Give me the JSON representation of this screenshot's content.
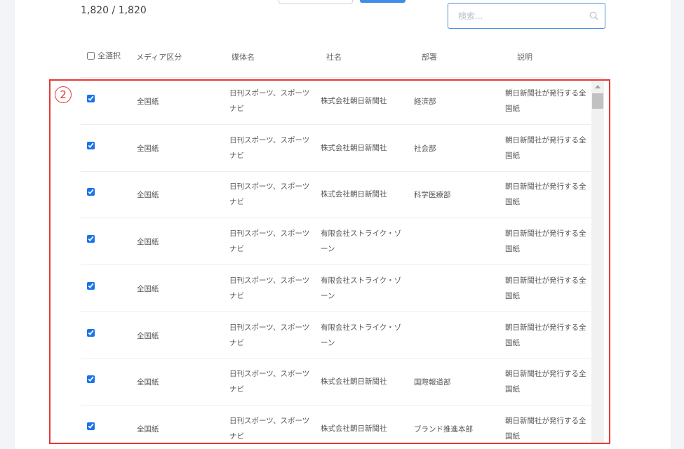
{
  "header": {
    "count_text": "1,820 / 1,820"
  },
  "search": {
    "placeholder": "検索..."
  },
  "table": {
    "columns": {
      "select_all": "全選択",
      "media_type": "メディア区分",
      "outlet": "媒体名",
      "company": "社名",
      "department": "部署",
      "description": "説明"
    },
    "rows": [
      {
        "checked": true,
        "media": "全国紙",
        "outlet": "日刊スポーツ、スポーツナビ",
        "company": "株式会社朝日新聞社",
        "dept": "経済部",
        "desc": "朝日新聞社が発行する全国紙"
      },
      {
        "checked": true,
        "media": "全国紙",
        "outlet": "日刊スポーツ、スポーツナビ",
        "company": "株式会社朝日新聞社",
        "dept": "社会部",
        "desc": "朝日新聞社が発行する全国紙"
      },
      {
        "checked": true,
        "media": "全国紙",
        "outlet": "日刊スポーツ、スポーツナビ",
        "company": "株式会社朝日新聞社",
        "dept": "科学医療部",
        "desc": "朝日新聞社が発行する全国紙"
      },
      {
        "checked": true,
        "media": "全国紙",
        "outlet": "日刊スポーツ、スポーツナビ",
        "company": "有限会社ストライク・ゾーン",
        "dept": "",
        "desc": "朝日新聞社が発行する全国紙"
      },
      {
        "checked": true,
        "media": "全国紙",
        "outlet": "日刊スポーツ、スポーツナビ",
        "company": "有限会社ストライク・ゾーン",
        "dept": "",
        "desc": "朝日新聞社が発行する全国紙"
      },
      {
        "checked": true,
        "media": "全国紙",
        "outlet": "日刊スポーツ、スポーツナビ",
        "company": "有限会社ストライク・ゾーン",
        "dept": "",
        "desc": "朝日新聞社が発行する全国紙"
      },
      {
        "checked": true,
        "media": "全国紙",
        "outlet": "日刊スポーツ、スポーツナビ",
        "company": "株式会社朝日新聞社",
        "dept": "国際報道部",
        "desc": "朝日新聞社が発行する全国紙"
      },
      {
        "checked": true,
        "media": "全国紙",
        "outlet": "日刊スポーツ、スポーツナビ",
        "company": "株式会社朝日新聞社",
        "dept": "ブランド推進本部",
        "desc": "朝日新聞社が発行する全国紙"
      }
    ]
  },
  "annotation": {
    "marker": "2",
    "color": "#e53935"
  },
  "colors": {
    "accent": "#3d8ee6",
    "search_border": "#4a90e2"
  },
  "icons": {
    "search": "search-icon",
    "scroll_up": "chevron-up-icon"
  }
}
